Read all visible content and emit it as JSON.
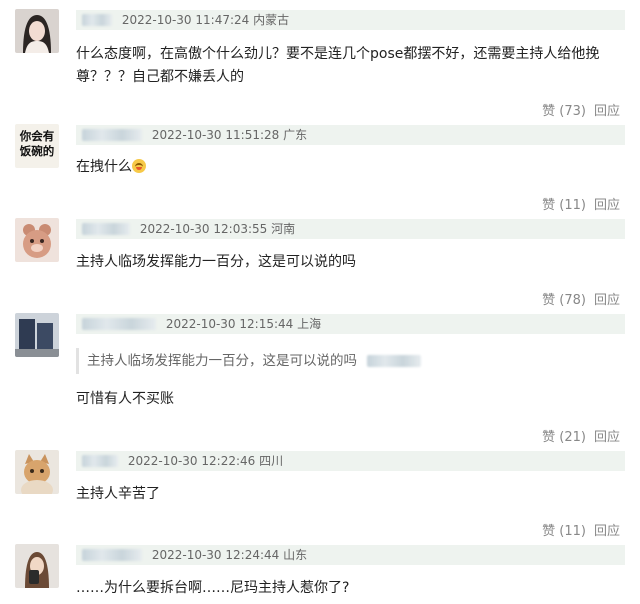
{
  "comments": [
    {
      "time": "2022-10-30 11:47:24",
      "location": "内蒙古",
      "text": "什么态度啊，在高傲个什么劲儿？要不是连几个pose都摆不好，还需要主持人给他挽尊？？？自己都不嫌丢人的",
      "like_label": "赞",
      "like_count": "(73)",
      "reply_label": "回应"
    },
    {
      "time": "2022-10-30 11:51:28",
      "location": "广东",
      "text": "在拽什么",
      "avatar_text_line1": "你会有",
      "avatar_text_line2": "饭碗的",
      "like_label": "赞",
      "like_count": "(11)",
      "reply_label": "回应"
    },
    {
      "time": "2022-10-30 12:03:55",
      "location": "河南",
      "text": "主持人临场发挥能力一百分，这是可以说的吗",
      "like_label": "赞",
      "like_count": "(78)",
      "reply_label": "回应"
    },
    {
      "time": "2022-10-30 12:15:44",
      "location": "上海",
      "quote": "主持人临场发挥能力一百分，这是可以说的吗",
      "text": "可惜有人不买账",
      "like_label": "赞",
      "like_count": "(21)",
      "reply_label": "回应"
    },
    {
      "time": "2022-10-30 12:22:46",
      "location": "四川",
      "text": "主持人辛苦了",
      "like_label": "赞",
      "like_count": "(11)",
      "reply_label": "回应"
    },
    {
      "time": "2022-10-30 12:24:44",
      "location": "山东",
      "text": "……为什么要拆台啊……尼玛主持人惹你了?"
    }
  ],
  "colors": {
    "meta_bg": "#eef3ef",
    "action_text": "#888888"
  }
}
